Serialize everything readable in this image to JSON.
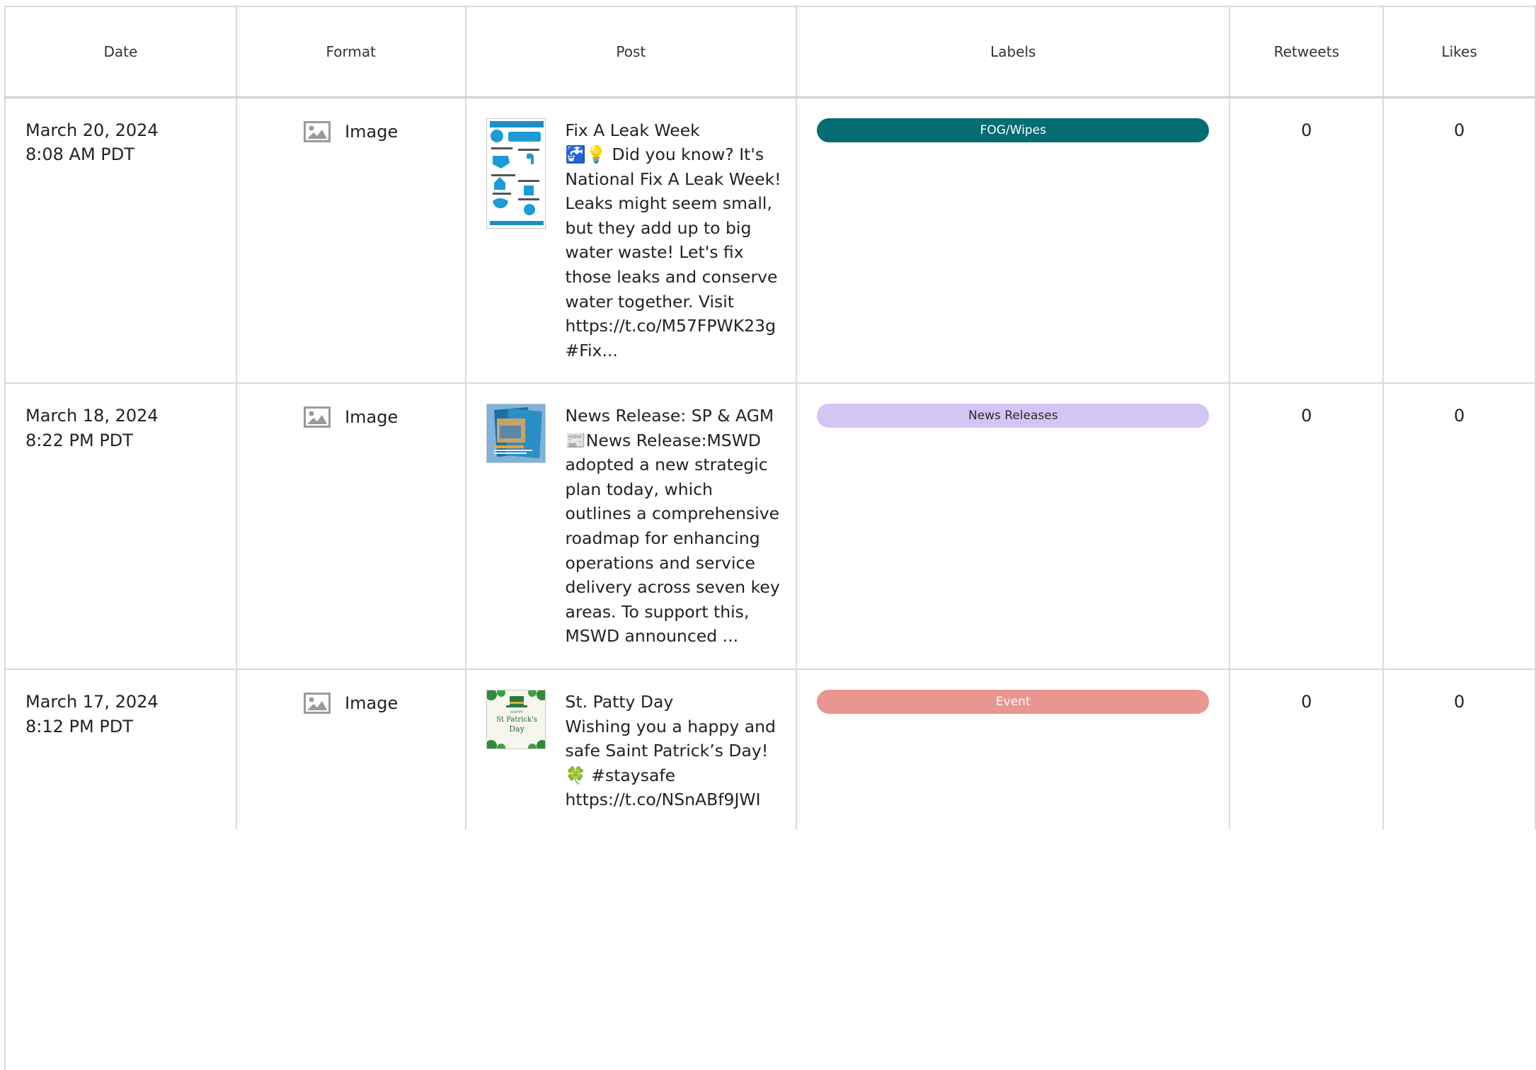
{
  "columns": {
    "date": "Date",
    "format": "Format",
    "post": "Post",
    "labels": "Labels",
    "retweets": "Retweets",
    "likes": "Likes"
  },
  "rows": [
    {
      "date": "March 20, 2024",
      "time": "8:08 AM PDT",
      "format_icon": "image-icon",
      "format": "Image",
      "thumbnail": "fix-a-leak-infographic",
      "post_title": "Fix A Leak Week",
      "post_body": "🚰💡 Did you know? It's National Fix A Leak Week! Leaks might seem small, but they add up to big water waste! Let's fix those leaks and conserve water together. Visit https://t.co/M57FPWK23g #Fix...",
      "label": "FOG/Wipes",
      "label_bg": "#046c73",
      "label_fg": "#ffffff",
      "retweets": "0",
      "likes": "0"
    },
    {
      "date": "March 18, 2024",
      "time": "8:22 PM PDT",
      "format_icon": "image-icon",
      "format": "Image",
      "thumbnail": "news-release-brochure",
      "post_title": "News Release: SP & AGM",
      "post_body": "📰News Release:MSWD adopted a new strategic plan today, which outlines a comprehensive roadmap for enhancing operations and service delivery across seven key areas. To support this, MSWD announced ...",
      "label": "News Releases",
      "label_bg": "#d4c5f5",
      "label_fg": "#2b2b2b",
      "retweets": "0",
      "likes": "0"
    },
    {
      "date": "March 17, 2024",
      "time": "8:12 PM PDT",
      "format_icon": "image-icon",
      "format": "Image",
      "thumbnail": "st-patricks-day-card",
      "post_title": "St. Patty Day",
      "post_body": "Wishing you a happy and safe Saint Patrick’s Day! 🍀 #staysafe https://t.co/NSnABf9JWI",
      "label": "Event",
      "label_bg": "#e99690",
      "label_fg": "#ffffff",
      "retweets": "0",
      "likes": "0"
    }
  ],
  "thumbnail_text": {
    "st_patricks": "St Patrick's Day",
    "st_patricks_top": "HAPPY"
  }
}
